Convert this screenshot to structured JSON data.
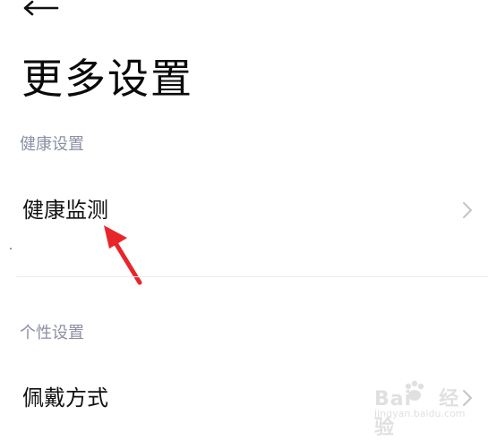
{
  "page": {
    "title": "更多设置"
  },
  "sections": [
    {
      "header": "健康设置",
      "items": [
        {
          "label": "健康监测"
        }
      ]
    },
    {
      "header": "个性设置",
      "items": [
        {
          "label": "佩戴方式"
        }
      ]
    }
  ],
  "icons": {
    "back": "back-arrow-icon",
    "chevron": "chevron-right-icon"
  },
  "annotation": {
    "arrow_color": "#e8262a"
  },
  "watermark": {
    "text": "Bai",
    "text2": "经验",
    "url": "jingyan.baidu.com"
  },
  "colors": {
    "section_header": "#8c90a6",
    "divider": "#ececec",
    "chevron": "#c4c4c4"
  }
}
